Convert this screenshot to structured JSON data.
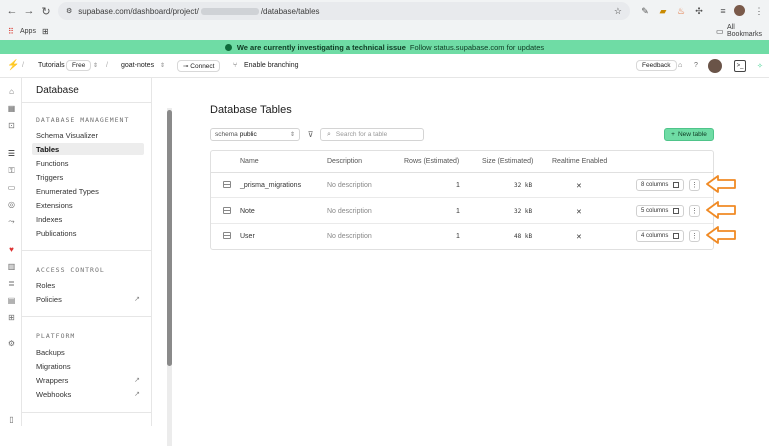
{
  "browser": {
    "url_prefix": "supabase.com/dashboard/project/",
    "url_suffix": "/database/tables",
    "bookmarks": {
      "apps": "Apps",
      "all": "All Bookmarks"
    }
  },
  "banner": {
    "message": "We are currently investigating a technical issue",
    "link": "Follow status.supabase.com for updates"
  },
  "topbar": {
    "org": "Tutorials",
    "plan": "Free",
    "project": "goat-notes",
    "connect": "Connect",
    "branching": "Enable branching",
    "feedback": "Feedback"
  },
  "sidebar": {
    "title": "Database",
    "sections": [
      {
        "header": "DATABASE MANAGEMENT",
        "items": [
          "Schema Visualizer",
          "Tables",
          "Functions",
          "Triggers",
          "Enumerated Types",
          "Extensions",
          "Indexes",
          "Publications"
        ]
      },
      {
        "header": "ACCESS CONTROL",
        "items": [
          "Roles",
          "Policies"
        ]
      },
      {
        "header": "PLATFORM",
        "items": [
          "Backups",
          "Migrations",
          "Wrappers",
          "Webhooks"
        ]
      }
    ],
    "active": "Tables"
  },
  "main": {
    "title": "Database Tables",
    "schema_label": "schema",
    "schema_value": "public",
    "search_placeholder": "Search for a table",
    "new_table": "New table",
    "columns": [
      "Name",
      "Description",
      "Rows (Estimated)",
      "Size (Estimated)",
      "Realtime Enabled"
    ],
    "rows": [
      {
        "name": "_prisma_migrations",
        "description": "No description",
        "rows": "1",
        "size": "32 kB",
        "realtime": "✕",
        "columns": "8 columns"
      },
      {
        "name": "Note",
        "description": "No description",
        "rows": "1",
        "size": "32 kB",
        "realtime": "✕",
        "columns": "5 columns"
      },
      {
        "name": "User",
        "description": "No description",
        "rows": "1",
        "size": "48 kB",
        "realtime": "✕",
        "columns": "4 columns"
      }
    ]
  },
  "colors": {
    "accent": "#6fdca5",
    "annotation": "#f08a24"
  }
}
